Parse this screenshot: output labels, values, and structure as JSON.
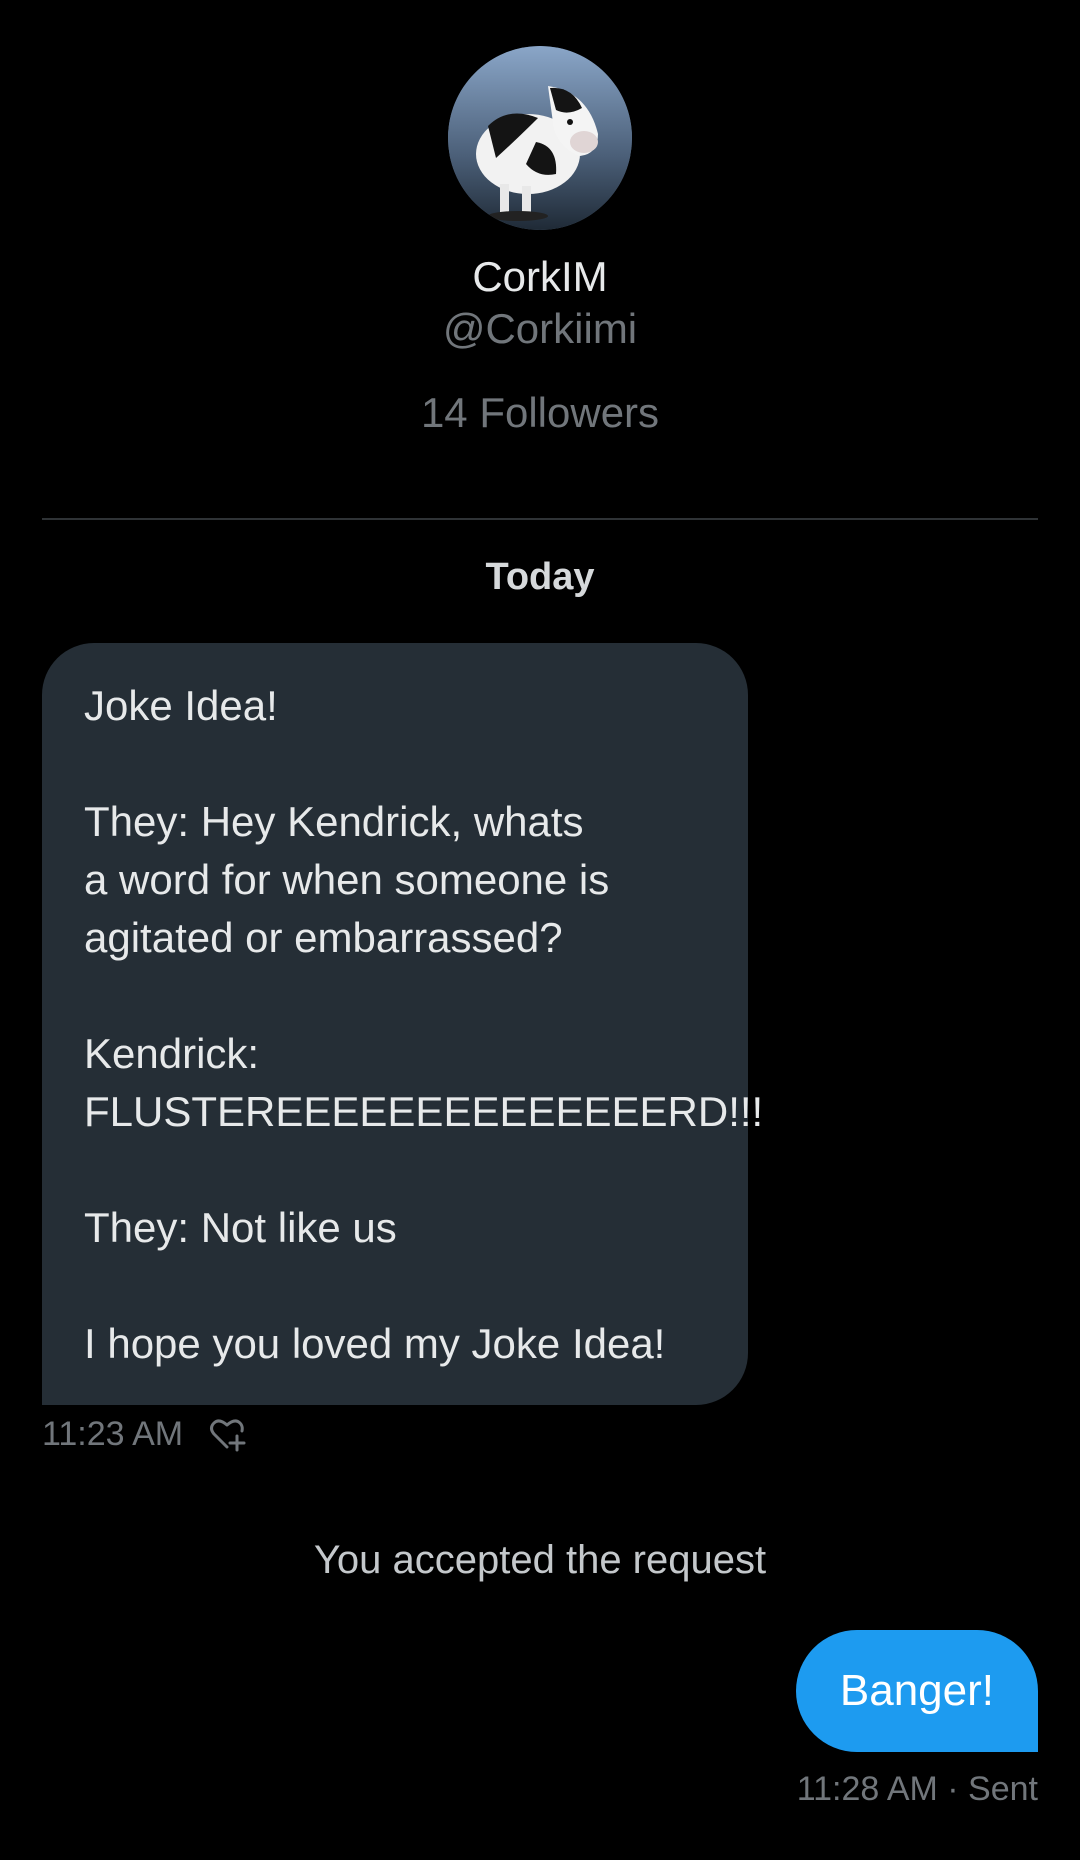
{
  "profile": {
    "display_name": "CorkIM",
    "handle": "@Corkiimi",
    "followers": "14 Followers"
  },
  "conversation": {
    "date_label": "Today",
    "incoming": {
      "text": "Joke Idea!\n\nThey: Hey Kendrick, whats\na word for when someone is\nagitated or embarrassed?\n\nKendrick:\nFLUSTEREEEEEEEEEEEEEERD!!!\n\nThey: Not like us\n\nI hope you loved my Joke Idea!",
      "time": "11:23 AM",
      "react_icon": "heart-plus-icon"
    },
    "system_message": "You accepted the request",
    "outgoing": {
      "text": "Banger!",
      "status": "11:28 AM · Sent"
    }
  },
  "colors": {
    "background": "#000000",
    "incoming_bubble": "#252e36",
    "outgoing_bubble": "#1d9bf0",
    "muted_text": "#71767b"
  }
}
